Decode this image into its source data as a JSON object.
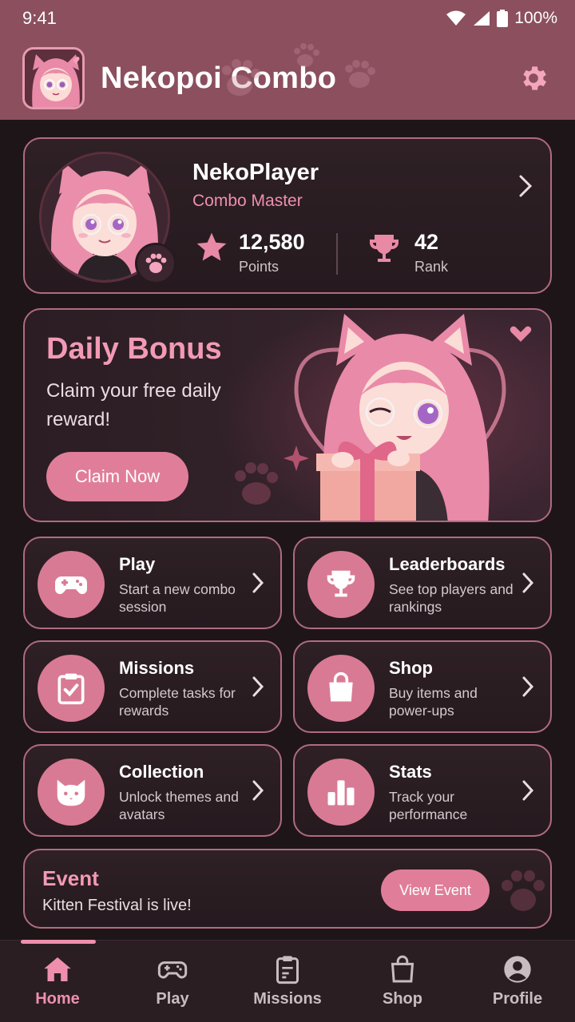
{
  "status_bar": {
    "time": "9:41",
    "battery": "100%"
  },
  "header": {
    "title": "Nekopoi Combo",
    "settings_icon": "gear-icon"
  },
  "profile": {
    "name": "NekoPlayer",
    "title": "Combo Master",
    "points_value": "12,580",
    "points_label": "Points",
    "rank_value": "42",
    "rank_label": "Rank"
  },
  "daily_bonus": {
    "title": "Daily Bonus",
    "subtitle": "Claim your free daily reward!",
    "button": "Claim Now"
  },
  "menu": [
    {
      "title": "Play",
      "desc": "Start a new combo session",
      "icon": "gamepad-icon"
    },
    {
      "title": "Leaderboards",
      "desc": "See top players and rankings",
      "icon": "trophy-icon"
    },
    {
      "title": "Missions",
      "desc": "Complete tasks for rewards",
      "icon": "clipboard-check-icon"
    },
    {
      "title": "Shop",
      "desc": "Buy items and power-ups",
      "icon": "shopping-bag-icon"
    },
    {
      "title": "Collection",
      "desc": "Unlock themes and avatars",
      "icon": "cat-icon"
    },
    {
      "title": "Stats",
      "desc": "Track your performance",
      "icon": "bar-chart-icon"
    }
  ],
  "event": {
    "title": "Event",
    "subtitle": "Kitten Festival is live!",
    "button": "View Event"
  },
  "bottom_nav": [
    {
      "label": "Home",
      "icon": "home-icon",
      "active": true
    },
    {
      "label": "Play",
      "icon": "gamepad-icon",
      "active": false
    },
    {
      "label": "Missions",
      "icon": "clipboard-icon",
      "active": false
    },
    {
      "label": "Shop",
      "icon": "shopping-bag-icon",
      "active": false
    },
    {
      "label": "Profile",
      "icon": "user-icon",
      "active": false
    }
  ],
  "colors": {
    "header_bg": "#8b4f5e",
    "accent_pink": "#e07e9a",
    "text_pink": "#ef8fae",
    "background": "#1e1518",
    "card_border": "#b06b80"
  }
}
